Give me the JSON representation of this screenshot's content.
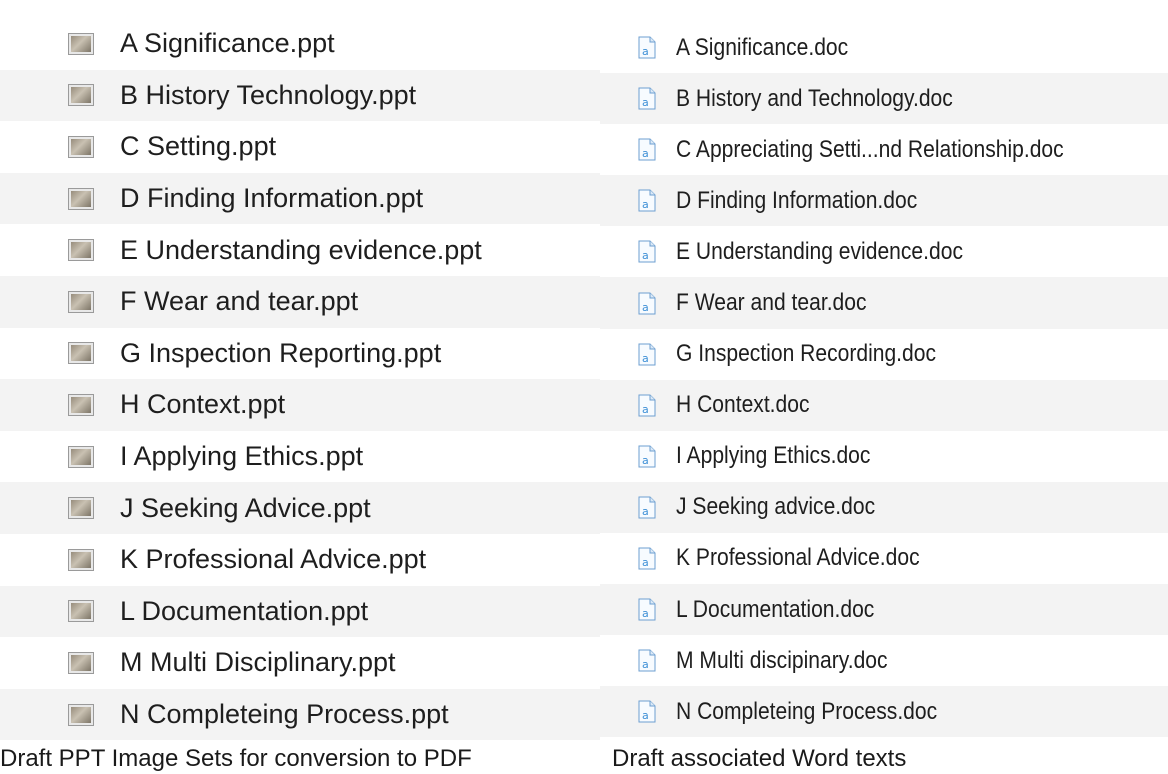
{
  "ppt_files": [
    {
      "name": "A Significance.ppt"
    },
    {
      "name": "B History Technology.ppt"
    },
    {
      "name": "C Setting.ppt"
    },
    {
      "name": "D Finding Information.ppt"
    },
    {
      "name": "E Understanding evidence.ppt"
    },
    {
      "name": "F Wear and tear.ppt"
    },
    {
      "name": "G Inspection Reporting.ppt"
    },
    {
      "name": "H Context.ppt"
    },
    {
      "name": "I Applying Ethics.ppt"
    },
    {
      "name": "J Seeking Advice.ppt"
    },
    {
      "name": "K Professional Advice.ppt"
    },
    {
      "name": "L Documentation.ppt"
    },
    {
      "name": "M Multi Disciplinary.ppt"
    },
    {
      "name": "N Completeing Process.ppt"
    }
  ],
  "doc_files": [
    {
      "name": "A Significance.doc"
    },
    {
      "name": "B History and Technology.doc"
    },
    {
      "name": "C Appreciating Setti...nd Relationship.doc"
    },
    {
      "name": "D Finding Information.doc"
    },
    {
      "name": "E Understanding evidence.doc"
    },
    {
      "name": "F Wear and tear.doc"
    },
    {
      "name": "G Inspection Recording.doc"
    },
    {
      "name": "H Context.doc"
    },
    {
      "name": "I Applying Ethics.doc"
    },
    {
      "name": "J Seeking advice.doc"
    },
    {
      "name": "K Professional Advice.doc"
    },
    {
      "name": "L Documentation.doc"
    },
    {
      "name": "M Multi discipinary.doc"
    },
    {
      "name": "N Completeing Process.doc"
    }
  ],
  "icons": {
    "ppt": "slide-thumbnail-icon",
    "doc": "word-document-icon"
  },
  "captions": {
    "left": "Draft PPT Image Sets for conversion to PDF",
    "right": "Draft associated Word texts"
  },
  "colors": {
    "row_alt": "#f3f3f3",
    "doc_icon_accent": "#3d8fd6"
  }
}
